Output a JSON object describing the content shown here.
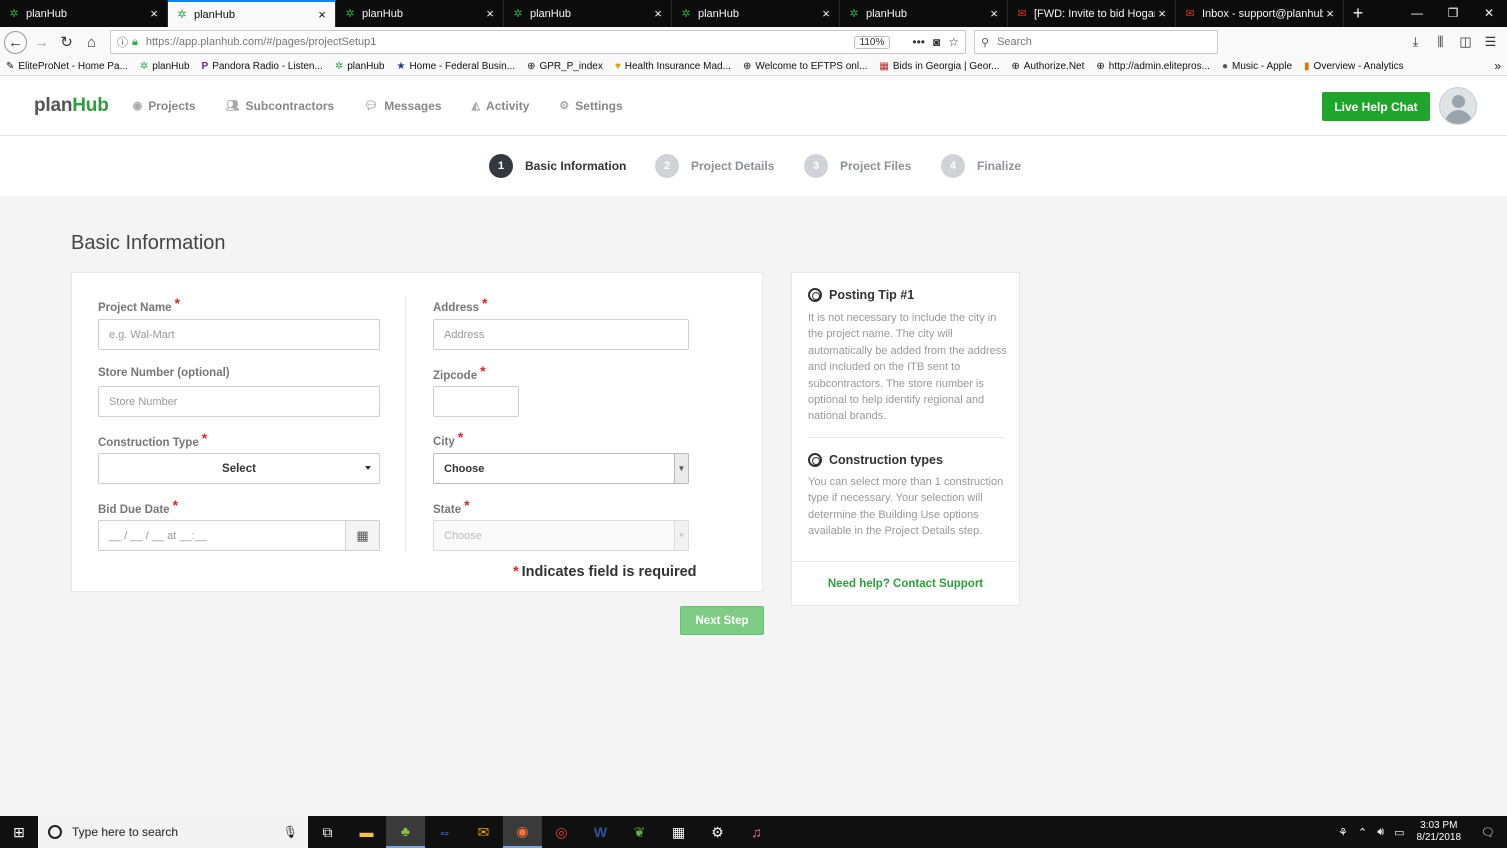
{
  "browser": {
    "tabs": [
      {
        "title": "planHub",
        "icon": "planhub-icon",
        "active": false
      },
      {
        "title": "planHub",
        "icon": "planhub-icon",
        "active": true
      },
      {
        "title": "planHub",
        "icon": "planhub-icon",
        "active": false
      },
      {
        "title": "planHub",
        "icon": "planhub-icon",
        "active": false
      },
      {
        "title": "planHub",
        "icon": "planhub-icon",
        "active": false
      },
      {
        "title": "planHub",
        "icon": "planhub-icon",
        "active": false
      },
      {
        "title": "[FWD: Invite to bid Hogansv",
        "icon": "gmail-icon",
        "active": false
      },
      {
        "title": "Inbox - support@planhub.co",
        "icon": "gmail-icon",
        "active": false
      }
    ],
    "url": "https://app.planhub.com/#/pages/projectSetup1",
    "zoom": "110%",
    "search_placeholder": "Search",
    "bookmarks": [
      "EliteProNet - Home Pa...",
      "planHub",
      "Pandora Radio - Listen...",
      "planHub",
      "Home - Federal Busin...",
      "GPR_P_index",
      "Health Insurance Mad...",
      "Welcome to EFTPS onl...",
      "Bids in Georgia | Geor...",
      "Authorize.Net",
      "http://admin.elitepros...",
      "Music - Apple",
      "Overview - Analytics"
    ]
  },
  "app": {
    "logo_plan": "plan",
    "logo_hub": "Hub",
    "nav": [
      {
        "label": "Projects",
        "icon": "projects-icon"
      },
      {
        "label": "Subcontractors",
        "icon": "users-icon"
      },
      {
        "label": "Messages",
        "icon": "comments-icon"
      },
      {
        "label": "Activity",
        "icon": "area-chart-icon"
      },
      {
        "label": "Settings",
        "icon": "gear-icon"
      }
    ],
    "live_chat": "Live Help Chat",
    "accent_color": "#1fa52b"
  },
  "stepper": {
    "steps": [
      {
        "num": "1",
        "label": "Basic Information",
        "current": true
      },
      {
        "num": "2",
        "label": "Project Details",
        "current": false
      },
      {
        "num": "3",
        "label": "Project Files",
        "current": false
      },
      {
        "num": "4",
        "label": "Finalize",
        "current": false
      }
    ]
  },
  "form": {
    "title": "Basic Information",
    "project_name": {
      "label": "Project Name",
      "placeholder": "e.g. Wal-Mart",
      "value": ""
    },
    "store_number": {
      "label": "Store Number (optional)",
      "placeholder": "Store Number",
      "value": ""
    },
    "construction_type": {
      "label": "Construction Type",
      "value": "Select"
    },
    "bid_due_date": {
      "label": "Bid Due Date",
      "placeholder": "__ / __ / __ at __:__"
    },
    "address": {
      "label": "Address",
      "placeholder": "Address",
      "value": ""
    },
    "zipcode": {
      "label": "Zipcode",
      "value": ""
    },
    "city": {
      "label": "City",
      "value": "Choose"
    },
    "state": {
      "label": "State",
      "value": "Choose"
    },
    "required_note": "Indicates field is required",
    "next_button": "Next Step"
  },
  "tips": {
    "tip1_title": "Posting Tip #1",
    "tip1_text": "It is not necessary to include the city in the project name. The city will automatically be added from the address and included on the ITB sent to subcontractors. The store number is optional to help identify regional and national brands.",
    "tip2_title": "Construction types",
    "tip2_text": "You can select more than 1 construction type if necessary. Your selection will determine the Building Use options available in the Project Details step.",
    "help_link": "Need help? Contact Support"
  },
  "taskbar": {
    "search_placeholder": "Type here to search",
    "time": "3:03 PM",
    "date": "8/21/2018"
  }
}
